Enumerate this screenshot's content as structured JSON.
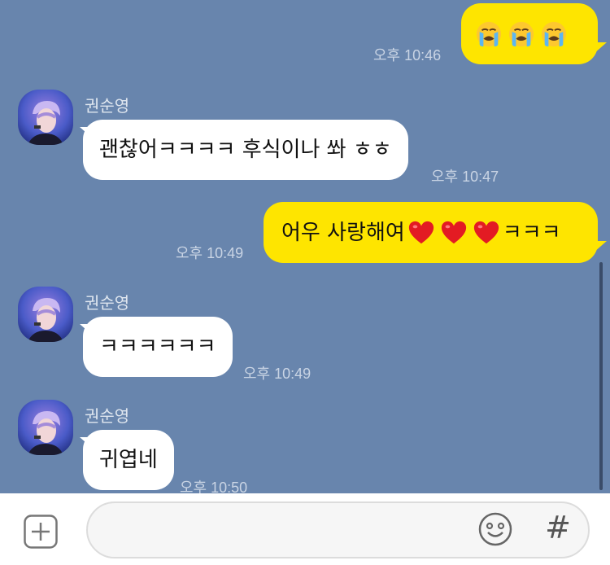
{
  "messages": [
    {
      "sender": "me",
      "text": "",
      "emojis": [
        "loudly-crying-face",
        "loudly-crying-face",
        "loudly-crying-face"
      ],
      "time": "오후 10:46"
    },
    {
      "sender": "other",
      "name": "권순영",
      "text": "괜찮어ㅋㅋㅋㅋ 후식이나 쏴 ㅎㅎ",
      "time": "오후 10:47"
    },
    {
      "sender": "me",
      "text_before": "어우 사랑해여",
      "emojis": [
        "red-heart",
        "red-heart",
        "red-heart"
      ],
      "text_after": "ㅋㅋㅋ",
      "time": "오후 10:49"
    },
    {
      "sender": "other",
      "name": "권순영",
      "text": "ㅋㅋㅋㅋㅋㅋ",
      "time": "오후 10:49"
    },
    {
      "sender": "other",
      "name": "권순영",
      "text": "귀엽네",
      "time": "오후 10:50"
    }
  ],
  "input": {
    "value": "",
    "placeholder": "",
    "plus_icon": "plus-icon",
    "emoji_icon": "emoji-icon",
    "hash_label": "#"
  },
  "colors": {
    "chat_background": "#6885ad",
    "my_bubble": "#fee500",
    "other_bubble": "#ffffff"
  }
}
